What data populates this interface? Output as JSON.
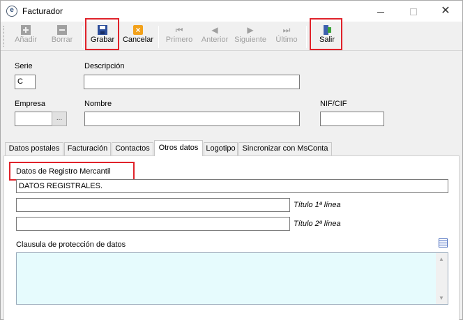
{
  "window": {
    "title": "Facturador",
    "icon": "app-e-icon"
  },
  "toolbar": {
    "add_label": "Añadir",
    "delete_label": "Borrar",
    "save_label": "Grabar",
    "cancel_label": "Cancelar",
    "first_label": "Primero",
    "previous_label": "Anterior",
    "next_label": "Siguiente",
    "last_label": "Último",
    "exit_label": "Salir"
  },
  "form": {
    "serie_label": "Serie",
    "serie_value": "C",
    "descripcion_label": "Descripción",
    "descripcion_value": "",
    "empresa_label": "Empresa",
    "empresa_value": "",
    "empresa_lookup": "...",
    "nombre_label": "Nombre",
    "nombre_value": "",
    "nif_label": "NIF/CIF",
    "nif_value": ""
  },
  "tabs": [
    {
      "label": "Datos postales"
    },
    {
      "label": "Facturación"
    },
    {
      "label": "Contactos"
    },
    {
      "label": "Otros datos"
    },
    {
      "label": "Logotipo"
    },
    {
      "label": "Sincronizar con MsConta"
    }
  ],
  "otros_datos": {
    "registro_label": "Datos de Registro Mercantil",
    "registro_value": "DATOS REGISTRALES.",
    "titulo1_value": "",
    "titulo1_label": "Título  1ª línea",
    "titulo2_value": "",
    "titulo2_label": "Título  2ª línea",
    "clausula_label": "Clausula de protección de datos",
    "clausula_value": ""
  },
  "colors": {
    "highlight": "#e0222a",
    "memo_bg": "#e6fbfd",
    "accent": "#2c4d9a"
  }
}
